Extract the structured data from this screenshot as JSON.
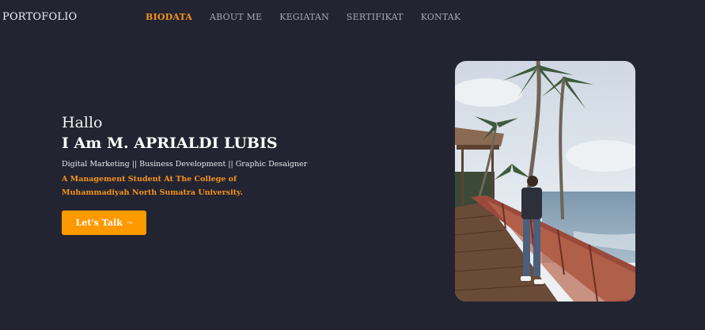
{
  "brand": "PORTOFOLIO",
  "nav": {
    "items": [
      {
        "label": "BIODATA",
        "active": true
      },
      {
        "label": "ABOUT ME",
        "active": false
      },
      {
        "label": "KEGIATAN",
        "active": false
      },
      {
        "label": "SERTIFIKAT",
        "active": false
      },
      {
        "label": "KONTAK",
        "active": false
      }
    ]
  },
  "hero": {
    "greeting": "Hallo",
    "name": "I Am M. APRIALDI LUBIS",
    "skills": "Digital Marketing || Business Development || Graphic Desaigner",
    "description": "A Management Student At The College of Muhammadiyah North Sumatra University.",
    "cta_label": "Let's Talk",
    "cta_arrow": "→"
  },
  "colors": {
    "background": "#232431",
    "accent": "#ff9900",
    "nav_text": "#a7a9b6"
  },
  "icons": {
    "cta": "arrow-right-icon"
  }
}
